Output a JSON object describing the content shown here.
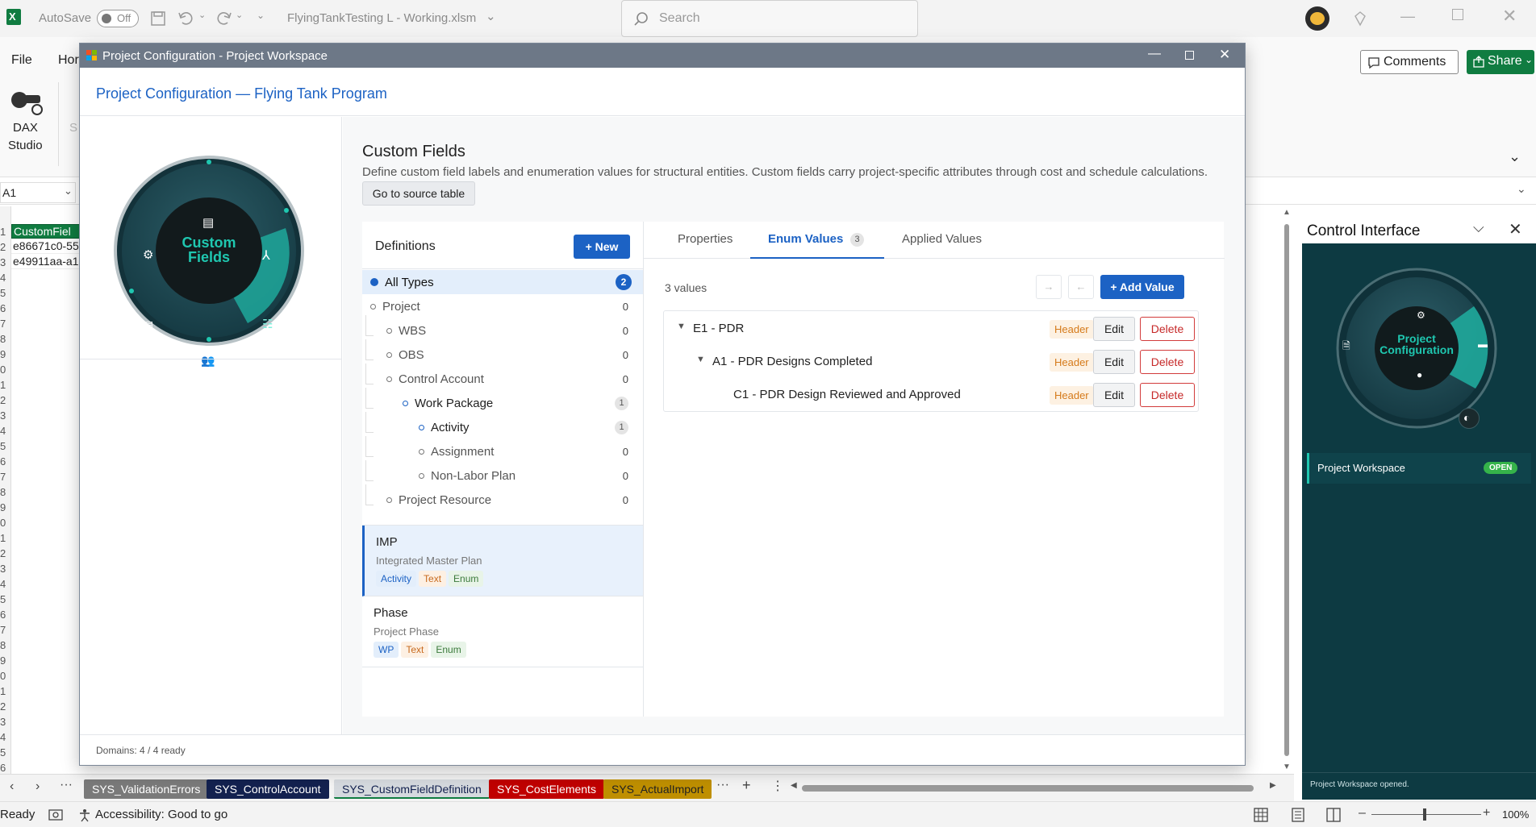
{
  "excel": {
    "autosave_label": "AutoSave",
    "autosave_state": "Off",
    "filename": "FlyingTankTesting L - Working.xlsm",
    "search_placeholder": "Search",
    "menu_file": "File",
    "menu_home": "Hor",
    "ribbon_dax_line1": "DAX",
    "ribbon_dax_line2": "Studio",
    "ribbon_s": "S",
    "ribbon_s2": "S",
    "comments_label": "Comments",
    "share_label": "Share",
    "name_box": "A1",
    "cells": [
      "CustomFiel",
      "e86671c0-55",
      "e49911aa-a1"
    ],
    "row_numbers": [
      "1",
      "2",
      "3",
      "4",
      "5",
      "6",
      "7",
      "8",
      "9",
      "0",
      "1",
      "2",
      "3",
      "4",
      "5",
      "6",
      "7",
      "8",
      "9",
      "0",
      "1",
      "2",
      "3",
      "4",
      "5",
      "6",
      "7",
      "8",
      "9",
      "0",
      "1",
      "2",
      "3",
      "4",
      "5",
      "6"
    ],
    "sheet_tabs": [
      {
        "label": "SYS_ValidationErrors",
        "bg": "#7a7a7a",
        "fg": "#ffffff"
      },
      {
        "label": "SYS_ControlAccount",
        "bg": "#13214f",
        "fg": "#ffffff"
      },
      {
        "label": "SYS_CustomFieldDefinition",
        "bg": "#d5d9de",
        "fg": "#13214f"
      },
      {
        "label": "SYS_CostElements",
        "bg": "#c00000",
        "fg": "#ffffff"
      },
      {
        "label": "SYS_ActualImport",
        "bg": "#bf8f00",
        "fg": "#222222"
      }
    ],
    "status_ready": "Ready",
    "status_accessibility": "Accessibility: Good to go",
    "zoom": "100%"
  },
  "dialog": {
    "window_title": "Project Configuration - Project Workspace",
    "header_title": "Project Configuration — Flying Tank Program",
    "wheel_center": [
      "Custom",
      "Fields"
    ],
    "section_title": "Custom Fields",
    "section_desc": "Define custom field labels and enumeration values for structural entities. Custom fields carry project-specific attributes through cost and schedule calculations.",
    "source_button": "Go to source table",
    "definitions_title": "Definitions",
    "new_button": "+ New",
    "tree": [
      {
        "label": "All Types",
        "count": "2"
      },
      {
        "label": "Project",
        "count": "0"
      },
      {
        "label": "WBS",
        "count": "0"
      },
      {
        "label": "OBS",
        "count": "0"
      },
      {
        "label": "Control Account",
        "count": "0"
      },
      {
        "label": "Work Package",
        "count": "1"
      },
      {
        "label": "Activity",
        "count": "1"
      },
      {
        "label": "Assignment",
        "count": "0"
      },
      {
        "label": "Non-Labor Plan",
        "count": "0"
      },
      {
        "label": "Project Resource",
        "count": "0"
      }
    ],
    "definitions": [
      {
        "name": "IMP",
        "desc": "Integrated Master Plan",
        "tags": [
          "Activity",
          "Text",
          "Enum"
        ]
      },
      {
        "name": "Phase",
        "desc": "Project Phase",
        "tags": [
          "WP",
          "Text",
          "Enum"
        ]
      }
    ],
    "tabs": {
      "properties": "Properties",
      "enum_values": "Enum Values",
      "enum_count": "3",
      "applied_values": "Applied Values"
    },
    "values_count": "3 values",
    "arrow_right": "→",
    "arrow_left": "←",
    "add_value": "+ Add Value",
    "enum_rows": [
      {
        "label": "E1 - PDR",
        "badge": "Header",
        "edit": "Edit",
        "delete": "Delete"
      },
      {
        "label": "A1 - PDR Designs Completed",
        "badge": "Header",
        "edit": "Edit",
        "delete": "Delete"
      },
      {
        "label": "C1 - PDR Design Reviewed and Approved",
        "badge": "Header",
        "edit": "Edit",
        "delete": "Delete"
      }
    ],
    "footer_status": "Domains: 4 / 4 ready"
  },
  "control": {
    "title": "Control Interface",
    "wheel_center": [
      "Project",
      "Configuration"
    ],
    "workspace_label": "Project Workspace",
    "workspace_badge": "OPEN",
    "log_message": "Project Workspace opened."
  },
  "colors": {
    "primary": "#1c62c4",
    "teal": "#1fc7b0",
    "excel_green": "#107c41",
    "danger": "#c62828",
    "header_badge": "#d57a1a"
  }
}
